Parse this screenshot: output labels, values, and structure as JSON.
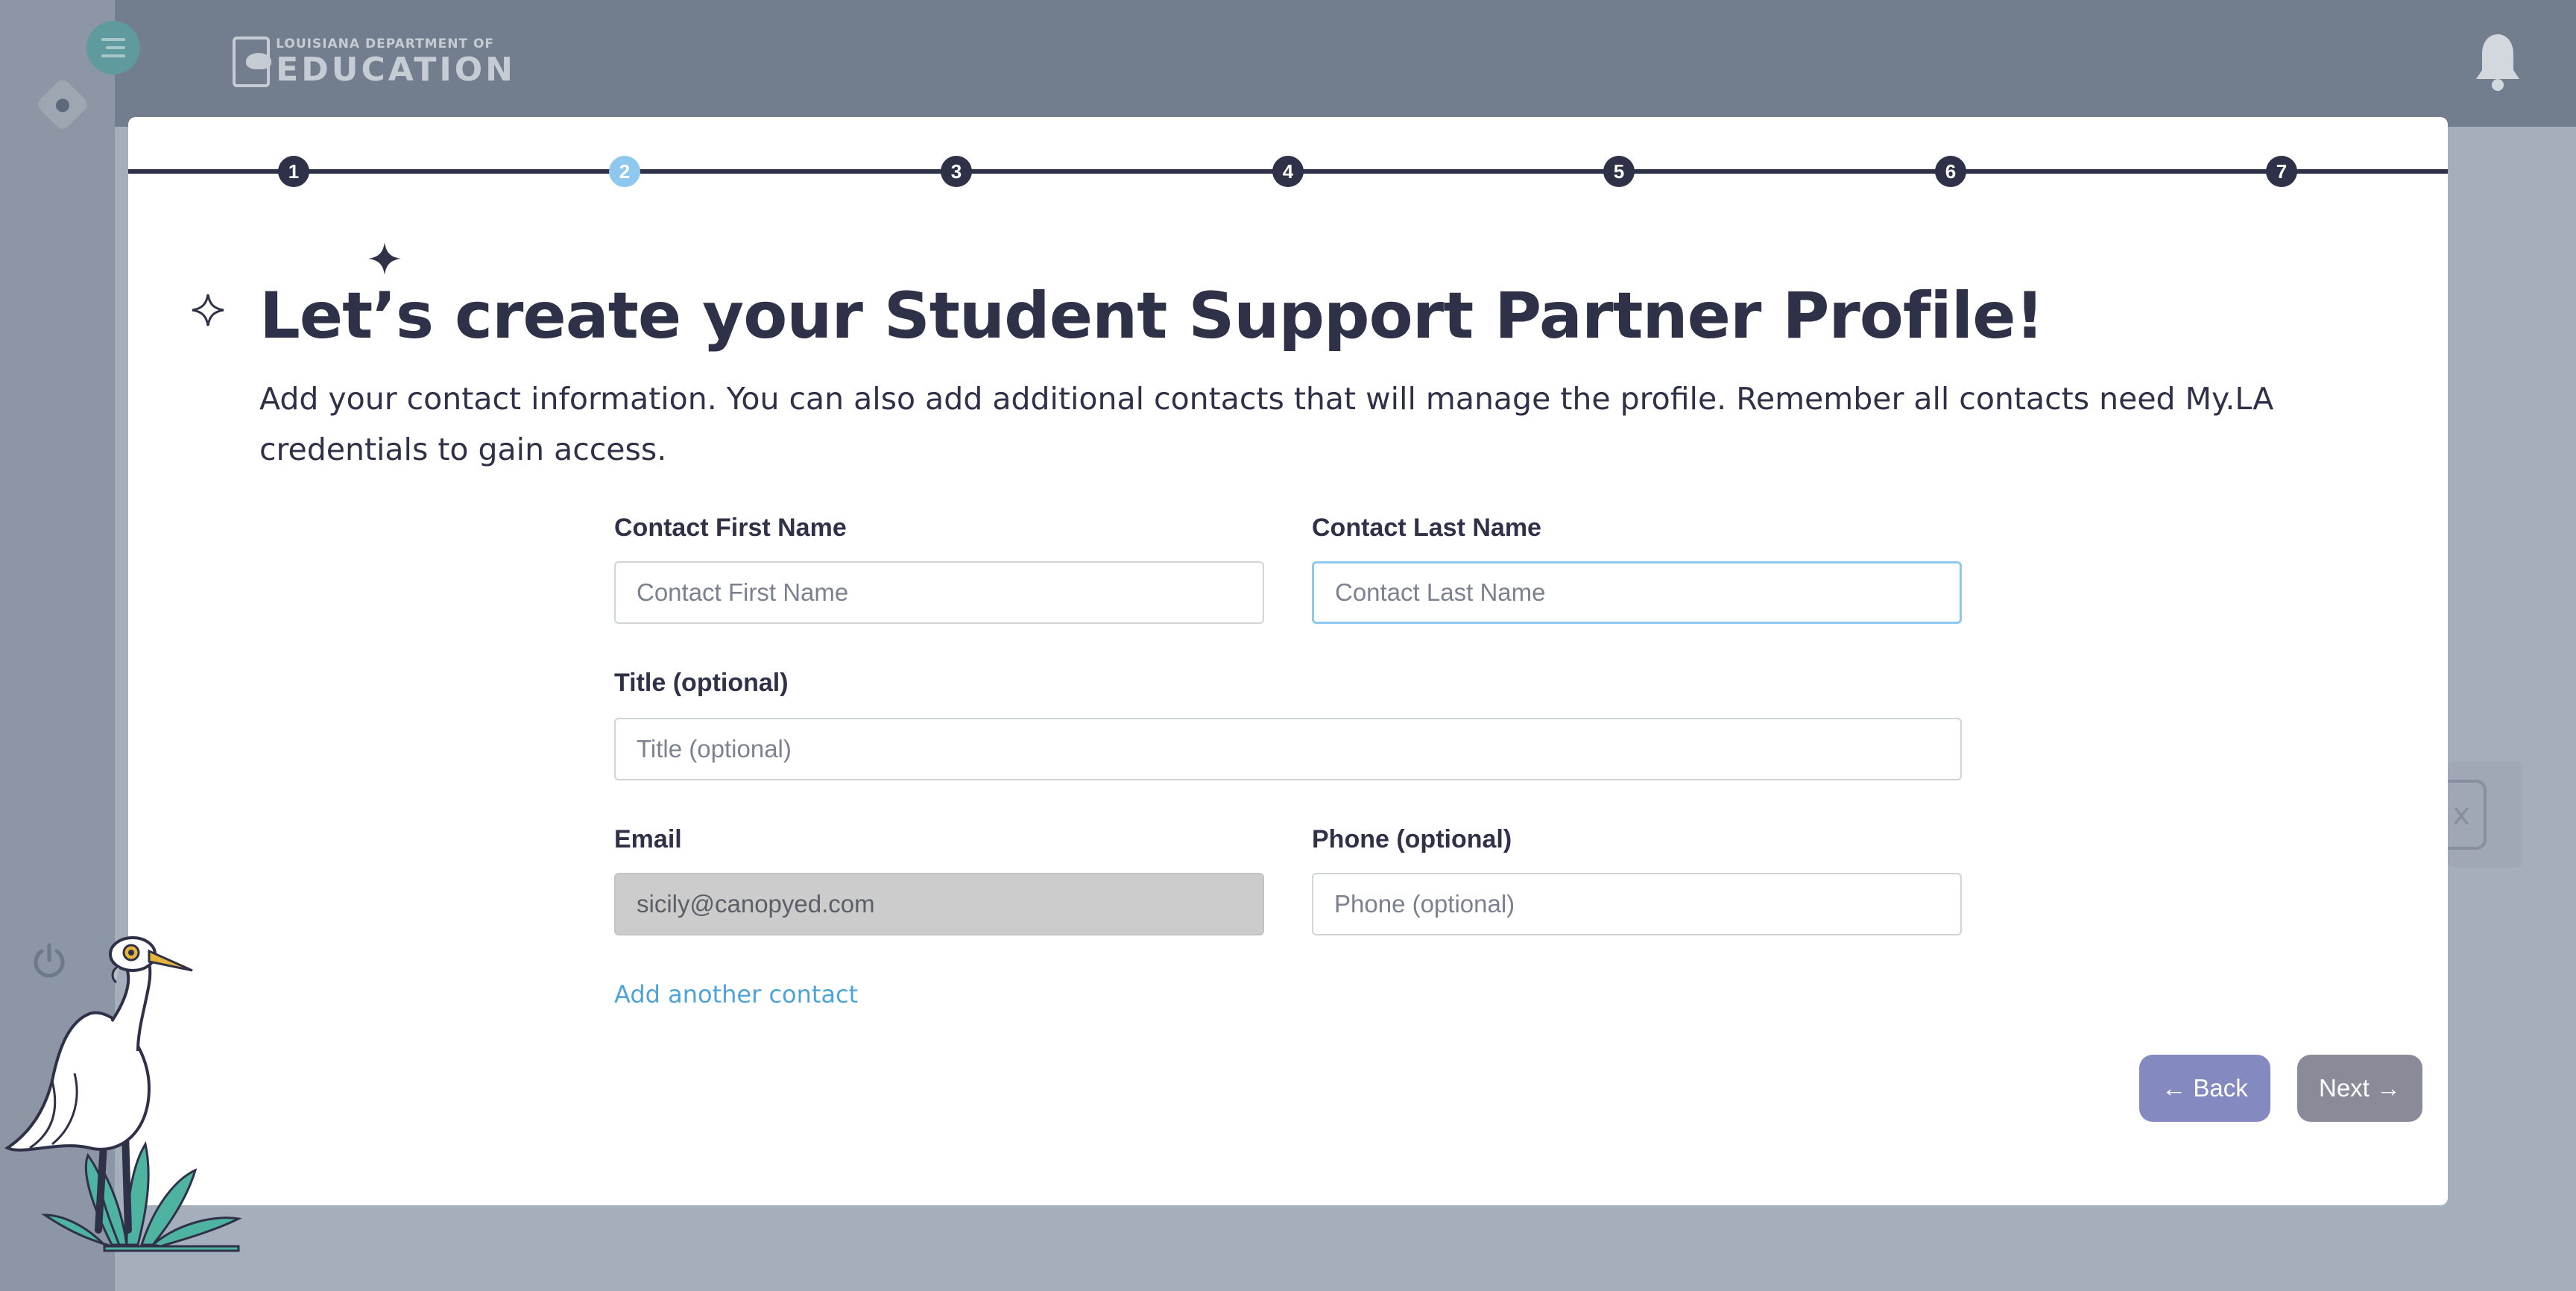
{
  "app": {
    "logo_small": "LOUISIANA DEPARTMENT OF",
    "logo_big": "EDUCATION"
  },
  "stepper": {
    "steps": [
      "1",
      "2",
      "3",
      "4",
      "5",
      "6",
      "7"
    ],
    "active_step": 2,
    "colors": {
      "inactive": "#2f3148",
      "active": "#8fc8ee"
    }
  },
  "header": {
    "title": "Let’s create your Student Support Partner Profile!",
    "subtitle": "Add your contact information. You can also add additional contacts that will manage the profile. Remember all contacts need My.LA credentials to gain access."
  },
  "form": {
    "first_name": {
      "label": "Contact First Name",
      "placeholder": "Contact First Name",
      "value": ""
    },
    "last_name": {
      "label": "Contact Last Name",
      "placeholder": "Contact Last Name",
      "value": ""
    },
    "title": {
      "label": "Title (optional)",
      "placeholder": "Title (optional)",
      "value": ""
    },
    "email": {
      "label": "Email",
      "value": "sicily@canopyed.com"
    },
    "phone": {
      "label": "Phone (optional)",
      "placeholder": "Phone (optional)",
      "value": ""
    },
    "add_contact_label": "Add another contact"
  },
  "actions": {
    "back_label": "← Back",
    "next_label": "Next →"
  },
  "background": {
    "card_button_label": "x"
  },
  "icons": {
    "menu": "hamburger-menu-icon",
    "toggle": "sidebar-toggle-icon",
    "bell": "notification-bell-icon",
    "power": "power-icon",
    "sparkles": "sparkle-icon"
  }
}
